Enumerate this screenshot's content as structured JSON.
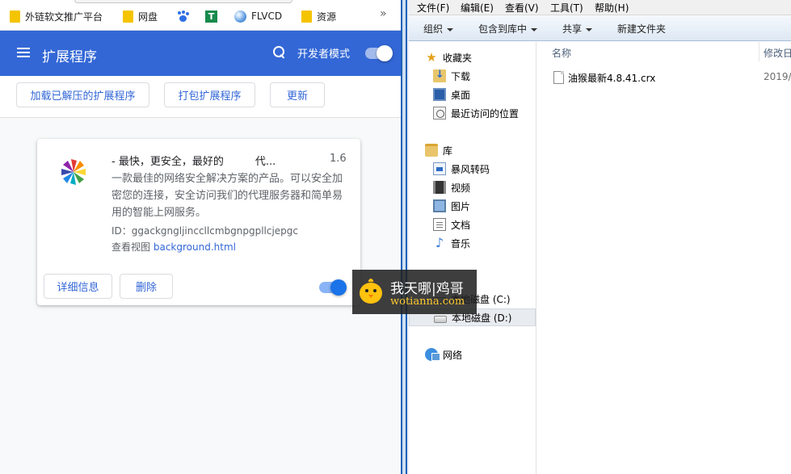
{
  "bookmarks": {
    "items": [
      {
        "label": "外链软文推广平台",
        "icon": "folder-icon"
      },
      {
        "label": "网盘",
        "icon": "folder-icon"
      },
      {
        "label": "",
        "icon": "baidu-paw-icon"
      },
      {
        "label": "",
        "icon": "t-square-icon",
        "glyph": "T"
      },
      {
        "label": "FLVCD",
        "icon": "globe-icon"
      },
      {
        "label": "资源",
        "icon": "folder-icon"
      }
    ],
    "more": "»"
  },
  "extensions_page": {
    "title": "扩展程序",
    "developer_mode_label": "开发者模式",
    "developer_mode_on": true,
    "toolbar": {
      "load_unpacked": "加载已解压的扩展程序",
      "pack_extension": "打包扩展程序",
      "update": "更新"
    },
    "card": {
      "name": "- 最快，更安全，最好的　　　代...",
      "version": "1.6",
      "description": "一款最佳的网络安全解决方案的产品。可以安全加密您的连接，安全访问我们的代理服务器和简单易用的智能上网服务。",
      "id_text": "ID：ggackgngljinccllcmbgnpgpllcjepgc",
      "inspect_label": "查看视图",
      "inspect_link": "background.html",
      "details_button": "详细信息",
      "remove_button": "删除",
      "enabled": true
    }
  },
  "watermark": {
    "line1": "我天哪|鸡哥",
    "line2": "wotianna.com"
  },
  "explorer": {
    "menu": [
      "文件(F)",
      "编辑(E)",
      "查看(V)",
      "工具(T)",
      "帮助(H)"
    ],
    "commands": [
      "组织",
      "包含到库中",
      "共享",
      "新建文件夹"
    ],
    "nav": {
      "favorites": "收藏夹",
      "downloads": "下载",
      "desktop": "桌面",
      "recent": "最近访问的位置",
      "libraries": "库",
      "storm": "暴风转码",
      "videos": "视频",
      "pictures": "图片",
      "documents": "文档",
      "music": "音乐",
      "drive_c": "本地磁盘 (C:)",
      "drive_d": "本地磁盘 (D:)",
      "network": "网络"
    },
    "columns": {
      "name": "名称",
      "modified": "修改日"
    },
    "files": [
      {
        "name": "油猴最新4.8.41.crx",
        "modified": "2019/"
      }
    ]
  },
  "colors": {
    "chrome_blue": "#3367d6",
    "link_blue": "#1a73e8",
    "watermark_yellow": "#ffcb2e"
  }
}
